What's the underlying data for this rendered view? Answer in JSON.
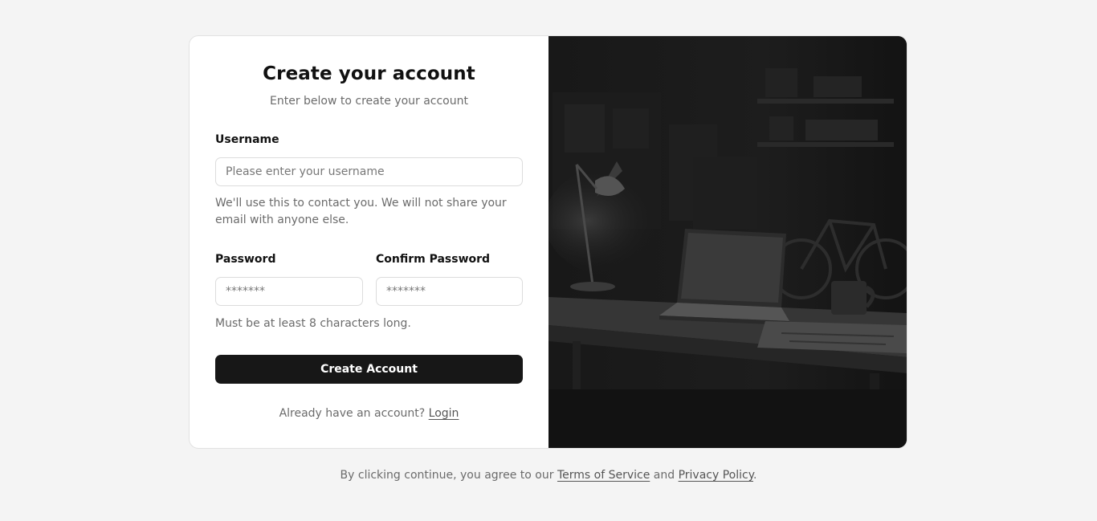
{
  "form": {
    "title": "Create your account",
    "subtitle": "Enter below to create your account",
    "username": {
      "label": "Username",
      "placeholder": "Please enter your username",
      "value": "",
      "hint": "We'll use this to contact you. We will not share your email with anyone else."
    },
    "password": {
      "label": "Password",
      "placeholder": "*******",
      "value": ""
    },
    "confirm_password": {
      "label": "Confirm Password",
      "placeholder": "*******",
      "value": ""
    },
    "password_hint": "Must be at least 8 characters long.",
    "submit_label": "Create Account",
    "login_prompt": "Already have an account?",
    "login_link": "Login"
  },
  "footer": {
    "prefix": "By clicking continue, you agree to our",
    "terms_link": "Terms of Service",
    "conjunction": "and",
    "privacy_link": "Privacy Policy",
    "suffix": "."
  },
  "image": {
    "icon": "desk-workspace-photo",
    "tone": "#111111"
  }
}
